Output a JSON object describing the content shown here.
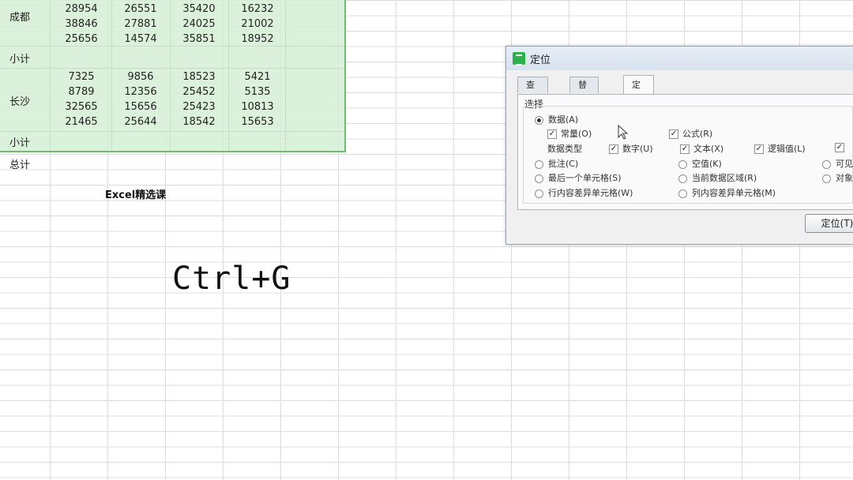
{
  "sheet": {
    "groups": [
      {
        "label": "成都",
        "rows": [
          [
            "28954",
            "26551",
            "35420",
            "16232"
          ],
          [
            "38846",
            "27881",
            "24025",
            "21002"
          ],
          [
            "25656",
            "14574",
            "35851",
            "18952"
          ]
        ]
      },
      {
        "label": "长沙",
        "rows": [
          [
            "7325",
            "9856",
            "18523",
            "5421"
          ],
          [
            "8789",
            "12356",
            "25452",
            "5135"
          ],
          [
            "32565",
            "15656",
            "25423",
            "10813"
          ],
          [
            "21465",
            "25644",
            "18542",
            "15653"
          ]
        ]
      }
    ],
    "subtotal_label": "小计",
    "total_label": "总计",
    "footer_text": "Excel精选课"
  },
  "overlay": {
    "shortcut": "Ctrl+G"
  },
  "dialog": {
    "title": "定位",
    "tabs": [
      "查找(D)",
      "替换(P)",
      "定位(G)"
    ],
    "active_tab": 2,
    "section_label": "选择",
    "options": {
      "data": "数据(A)",
      "constant": "常量(O)",
      "formula": "公式(R)",
      "data_type_label": "数据类型",
      "number": "数字(U)",
      "text": "文本(X)",
      "logical": "逻辑值(L)",
      "comment": "批注(C)",
      "blank": "空值(K)",
      "visible": "可见",
      "last_cell": "最后一个单元格(S)",
      "current_region": "当前数据区域(R)",
      "object": "对象",
      "row_diff": "行内容差异单元格(W)",
      "col_diff": "列内容差异单元格(M)"
    },
    "button_label": "定位(T)"
  }
}
